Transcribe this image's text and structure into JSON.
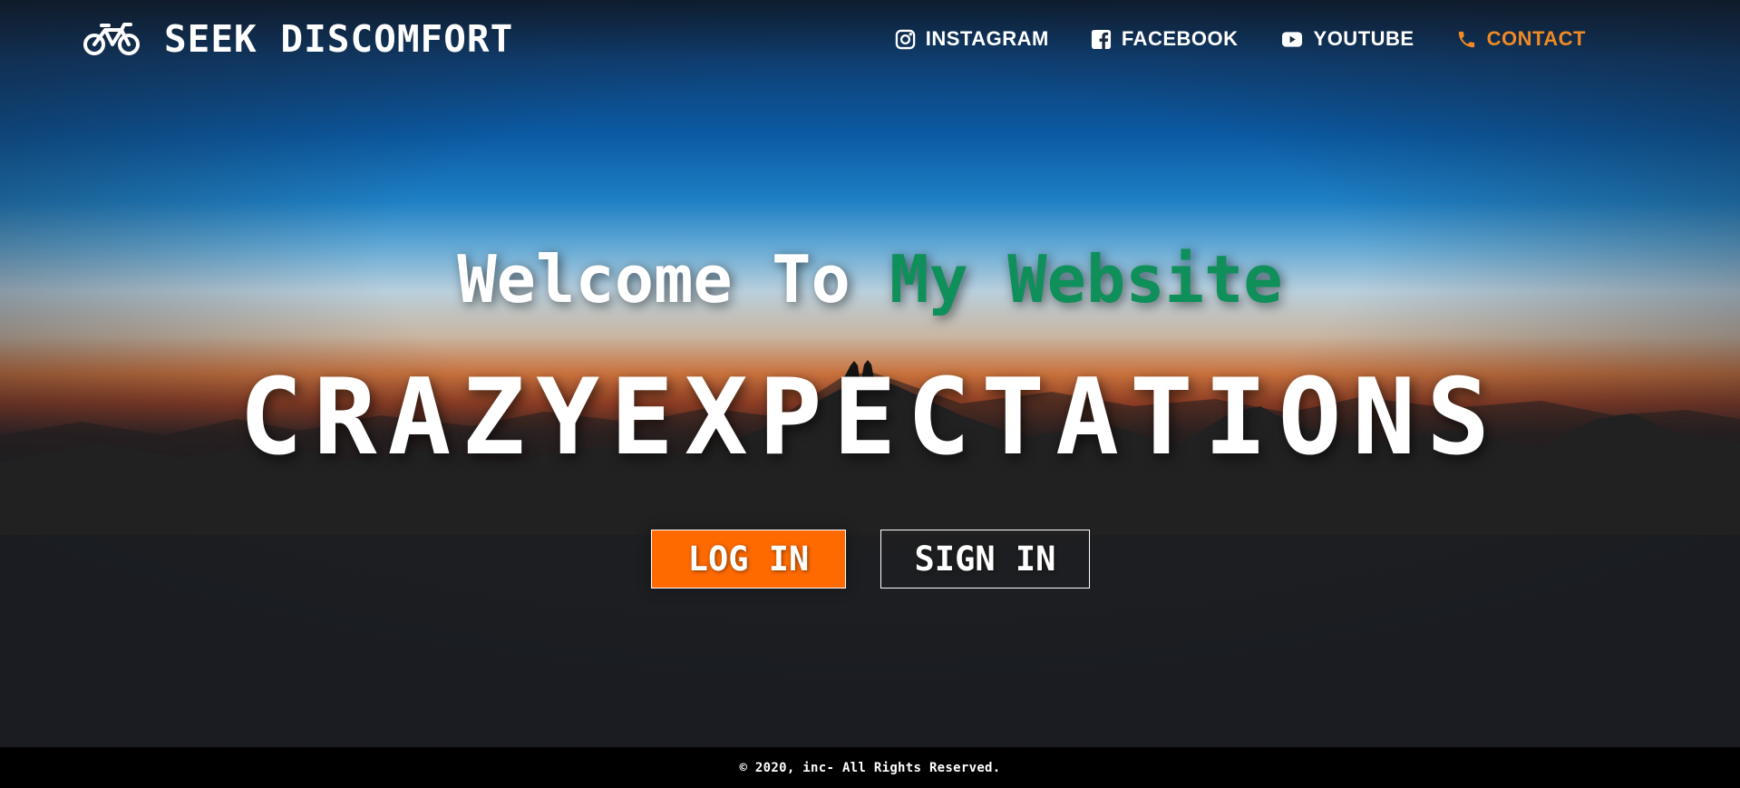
{
  "brand": {
    "title": "SEEK DISCOMFORT",
    "icon": "bicycle-icon"
  },
  "nav": {
    "items": [
      {
        "label": "INSTAGRAM",
        "icon": "instagram-icon",
        "active": false
      },
      {
        "label": "FACEBOOK",
        "icon": "facebook-icon",
        "active": false
      },
      {
        "label": "YOUTUBE",
        "icon": "youtube-icon",
        "active": false
      },
      {
        "label": "CONTACT",
        "icon": "phone-icon",
        "active": true
      }
    ]
  },
  "hero": {
    "welcome_prefix": "Welcome To",
    "welcome_accent": "My Website",
    "headline": "CRAZYEXPECTATIONS"
  },
  "buttons": {
    "login_label": "LOG IN",
    "signin_label": "SIGN IN"
  },
  "footer": {
    "text": "© 2020, inc- All Rights Reserved."
  },
  "colors": {
    "accent_orange": "#ff6a00",
    "nav_active": "#f08a24",
    "welcome_green": "#0f8f5a",
    "background": "#202020",
    "footer": "#000000"
  }
}
